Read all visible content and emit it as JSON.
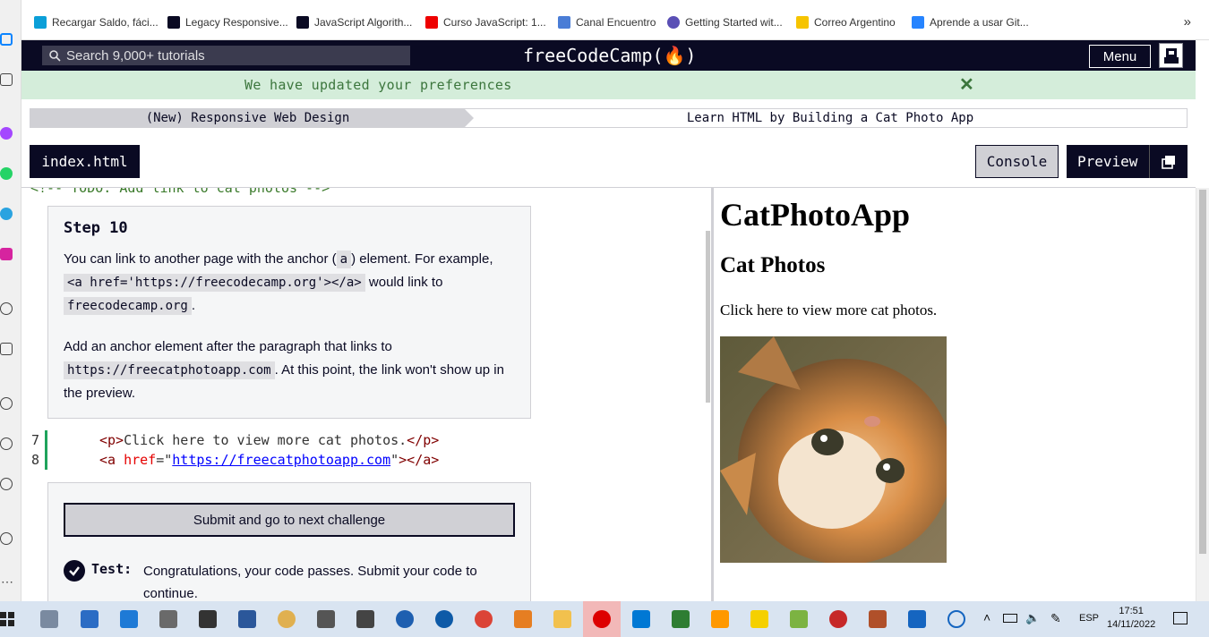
{
  "bookmarks": [
    "Recargar Saldo, fáci...",
    "Legacy Responsive...",
    "JavaScript Algorith...",
    "Curso JavaScript: 1...",
    "Canal Encuentro",
    "Getting Started wit...",
    "Correo Argentino",
    "Aprende a usar Git..."
  ],
  "bookmarks_more": "»",
  "nav": {
    "search_placeholder": "Search 9,000+ tutorials",
    "logo": "freeCodeCamp(🔥)",
    "menu_label": "Menu"
  },
  "flash": {
    "message": "We have updated your preferences",
    "close": "✕"
  },
  "breadcrumb": {
    "superblock": "(New) Responsive Web Design",
    "block": "Learn HTML by Building a Cat Photo App"
  },
  "tabs": {
    "file": "index.html",
    "console": "Console",
    "preview": "Preview"
  },
  "editor": {
    "cut_line": "<!-- TODO: Add link to cat photos -->",
    "step_title": "Step 10",
    "p1_a": "You can link to another page with the anchor (",
    "p1_code1": "a",
    "p1_b": ") element. For example, ",
    "p1_code2": "<a href='https://freecodecamp.org'></a>",
    "p1_c": " would link to ",
    "p1_code3": "freecodecamp.org",
    "p1_d": ".",
    "p2_a": "Add an anchor element after the paragraph that links to ",
    "p2_code": "https://freecatphotoapp.com",
    "p2_b": ". At this point, the link won't show up in the preview.",
    "lines": [
      {
        "num": "7",
        "indent": "    ",
        "t1": "<p>",
        "text": "Click here to view more cat photos.",
        "t2": "</p>"
      },
      {
        "num": "8",
        "indent": "    ",
        "t1": "<a ",
        "attr": "href",
        "eq": "=\"",
        "val": "https://freecatphotoapp.com",
        "q": "\"",
        "t2": "></a>"
      }
    ],
    "submit_label": "Submit and go to next challenge",
    "test_label": "Test:",
    "test_text": "Congratulations, your code passes. Submit your code to continue."
  },
  "preview": {
    "h1": "CatPhotoApp",
    "h2": "Cat Photos",
    "p": "Click here to view more cat photos."
  },
  "taskbar": {
    "lang": "ESP",
    "time": "17:51",
    "date": "14/11/2022"
  },
  "colors": {
    "fcc_dark": "#0a0a23",
    "flash_bg": "#d4edda",
    "flash_text": "#3c763d"
  }
}
